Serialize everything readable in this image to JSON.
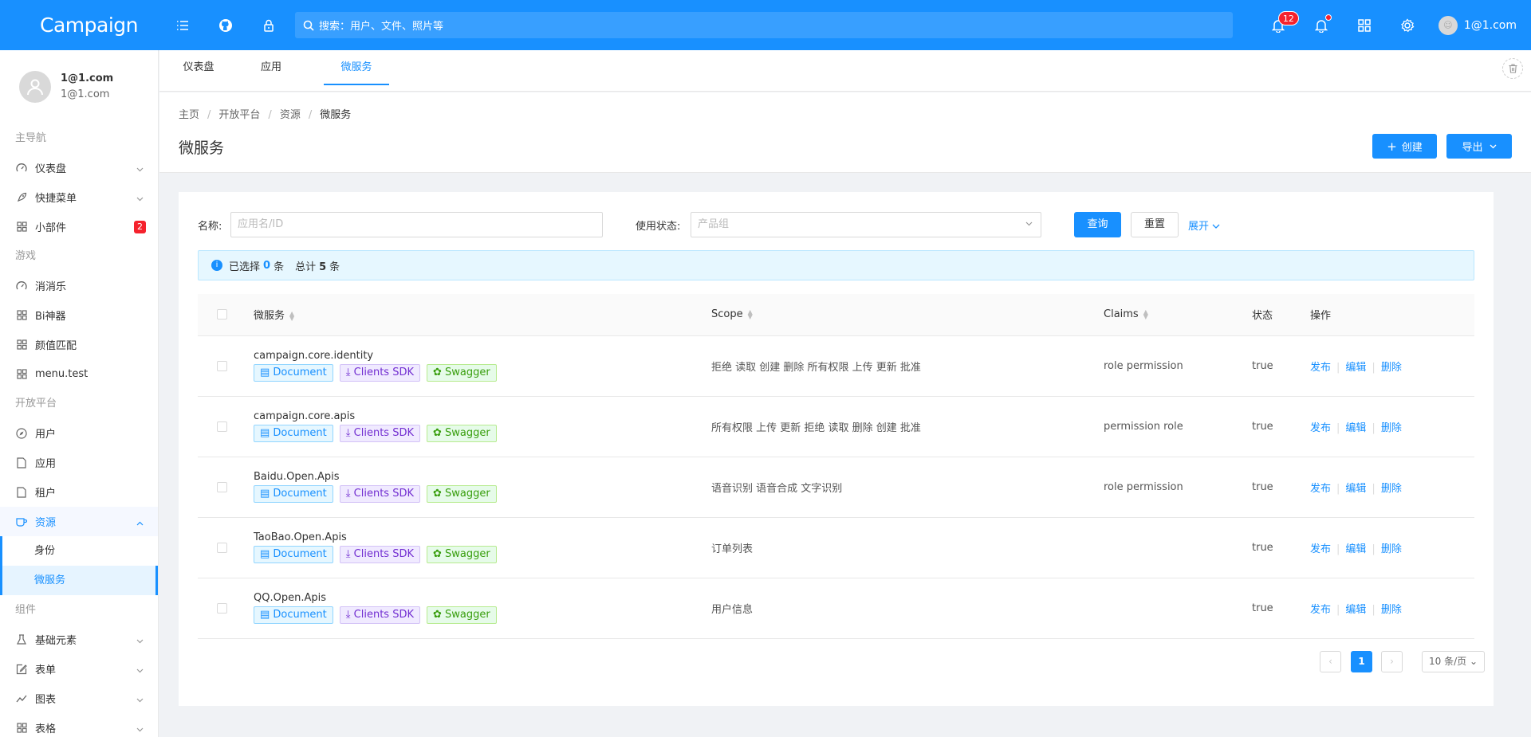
{
  "header": {
    "brand": "Campaign",
    "search_text": "搜索：用户、文件、照片等",
    "notification_count": "12",
    "user": "1@1.com"
  },
  "sidebar": {
    "profile_name": "1@1.com",
    "profile_email": "1@1.com",
    "groups": {
      "main": "主导航",
      "games": "游戏",
      "platform": "开放平台",
      "components": "组件"
    },
    "items": {
      "dashboard": "仪表盘",
      "shortcut": "快捷菜单",
      "widgets": "小部件",
      "widgets_badge": "2",
      "xiaoxiaole": "消消乐",
      "bi": "Bi神器",
      "face": "颜值匹配",
      "menu_test": "menu.test",
      "users": "用户",
      "apps": "应用",
      "tenants": "租户",
      "resources": "资源",
      "identity": "身份",
      "microservice": "微服务",
      "basic": "基础元素",
      "forms": "表单",
      "charts": "图表",
      "tables": "表格"
    }
  },
  "tabs": [
    "仪表盘",
    "应用",
    "微服务"
  ],
  "breadcrumb": [
    "主页",
    "开放平台",
    "资源",
    "微服务"
  ],
  "page_title": "微服务",
  "buttons": {
    "create": "创建",
    "export": "导出"
  },
  "filters": {
    "name_label": "名称:",
    "name_placeholder": "应用名/ID",
    "status_label": "使用状态:",
    "status_placeholder": "产品组",
    "query": "查询",
    "reset": "重置",
    "expand": "展开"
  },
  "alert": {
    "selected_prefix": "已选择",
    "selected": "0",
    "unit": "条",
    "total_prefix": "总计",
    "total": "5"
  },
  "table": {
    "columns": {
      "service": "微服务",
      "scope": "Scope",
      "claims": "Claims",
      "status": "状态",
      "actions": "操作"
    },
    "tags": {
      "doc": "Document",
      "sdk": "Clients SDK",
      "swagger": "Swagger"
    },
    "action_labels": {
      "publish": "发布",
      "edit": "编辑",
      "delete": "删除"
    },
    "rows": [
      {
        "name": "campaign.core.identity",
        "scope": "拒绝 读取 创建 删除 所有权限 上传 更新 批准",
        "claims": "role permission",
        "status": "true"
      },
      {
        "name": "campaign.core.apis",
        "scope": "所有权限 上传 更新 拒绝 读取 删除 创建 批准",
        "claims": "permission role",
        "status": "true"
      },
      {
        "name": "Baidu.Open.Apis",
        "scope": "语音识别 语音合成 文字识别",
        "claims": "role permission",
        "status": "true"
      },
      {
        "name": "TaoBao.Open.Apis",
        "scope": "订单列表",
        "claims": "",
        "status": "true"
      },
      {
        "name": "QQ.Open.Apis",
        "scope": "用户信息",
        "claims": "",
        "status": "true"
      }
    ]
  },
  "pagination": {
    "current": "1",
    "page_size": "10 条/页"
  }
}
